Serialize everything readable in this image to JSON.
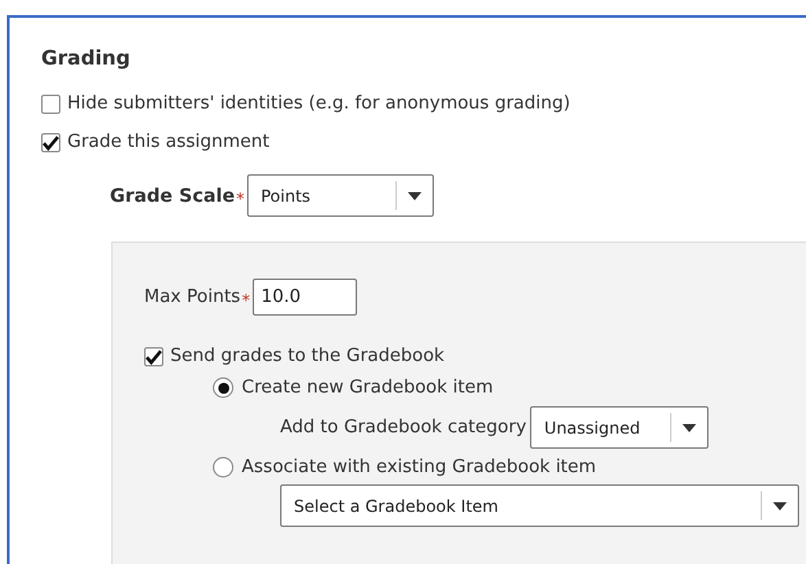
{
  "section": {
    "title": "Grading"
  },
  "options": [
    {
      "label": "Hide submitters' identities (e.g. for anonymous grading)",
      "checked": false
    },
    {
      "label": "Grade this assignment",
      "checked": true
    }
  ],
  "grade_scale": {
    "label": "Grade Scale",
    "required_mark": "*",
    "value": "Points"
  },
  "max_points": {
    "label": "Max Points",
    "required_mark": "*",
    "value": "10.0"
  },
  "gradebook": {
    "label": "Send grades to the Gradebook",
    "checked": true,
    "choices": [
      {
        "label": "Create new Gradebook item",
        "selected": true
      },
      {
        "label": "Associate with existing Gradebook item",
        "selected": false
      }
    ],
    "category": {
      "label": "Add to Gradebook category",
      "value": "Unassigned"
    },
    "existing_item": {
      "value": "Select a Gradebook Item"
    }
  }
}
